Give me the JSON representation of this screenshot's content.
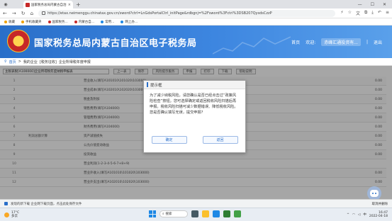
{
  "browser": {
    "tab_title": "国家税务总局内蒙古自治区电子税务局",
    "url": "https://etax.neimenggu.chinatax.gov.cn/sword?ctrl=LnGdsPortalCtrl_initPage&rdbgnj=%2Fsword%3Fctrl%3DSB207QysdsCzzP",
    "bookmarks": [
      "收藏",
      "手机收藏夹",
      "国家税务...",
      "内蒙古自...",
      "常用...",
      "网上办..."
    ]
  },
  "header": {
    "site_title": "国家税务总局内蒙古自治区电子税务局",
    "home_link": "首页",
    "welcome": "欢迎:",
    "user": "赤峰汇通投资有...",
    "exit": "退出"
  },
  "breadcrumb": {
    "home": "首页",
    "items": [
      "我的企业",
      "[税务征收]",
      "企业所得税年度申报"
    ]
  },
  "toolbar": {
    "select_value": "主税表税[A100000]企业所得税年度纳税申报表",
    "buttons": [
      "上一表",
      "保存",
      "风险提示服务",
      "申报",
      "打印",
      "下载",
      "帮助说明"
    ]
  },
  "table": {
    "rows": [
      {
        "no": "1",
        "group": "",
        "item": "营业收入(填写A101010\\101020\\103000)",
        "value": "0.00"
      },
      {
        "no": "2",
        "group": "",
        "item": "营业成本(填写A102010\\102020\\103000)",
        "value": "0.00"
      },
      {
        "no": "3",
        "group": "",
        "item": "税金及附加",
        "value": "0.00"
      },
      {
        "no": "4",
        "group": "",
        "item": "销售费用(填写A104000)",
        "value": "0.00"
      },
      {
        "no": "5",
        "group": "",
        "item": "管理费用(填写A104000)",
        "value": "0.00"
      },
      {
        "no": "6",
        "group": "",
        "item": "财务费用(填写A104000)",
        "value": "0.00"
      },
      {
        "no": "7",
        "group": "利润总额计算",
        "item": "资产减值损失",
        "value": "0.00"
      },
      {
        "no": "8",
        "group": "",
        "item": "公允价值变动收益",
        "value": "0.00"
      },
      {
        "no": "9",
        "group": "",
        "item": "投资收益",
        "value": "0.00"
      },
      {
        "no": "10",
        "group": "",
        "item": "营业利润(1-2-3-4-5-6-7+8+9)",
        "value": ""
      },
      {
        "no": "11",
        "group": "",
        "item": "营业外收入(填写A101010\\101020\\103000)",
        "value": "0.00"
      },
      {
        "no": "12",
        "group": "",
        "item": "营业外支出(填写A102010\\102020\\103000)",
        "value": "0.00"
      }
    ]
  },
  "dialog": {
    "title": "提示框",
    "message": "为了减少纳税风险，请您确认是否已经点击过“政策风险检查”按钮。您可选择确定或返回税收风险扫描后再申报。税收风险扫描可减少数据错误、降低税收风险。您是否确认填写无误，提交申报?",
    "ok_label": "确定",
    "back_label": "返回"
  },
  "downloads": {
    "text": "发现的新下载 企业网下载页面，点击此处保存文件",
    "right_text": "取消并删除"
  },
  "taskbar": {
    "temp": "17°C",
    "weather": "多云",
    "search": "搜索",
    "time": "16:47",
    "date": "2022-04-18"
  },
  "colors": {
    "accent": "#2a6fc9",
    "header_bg": "#3d86e0"
  }
}
